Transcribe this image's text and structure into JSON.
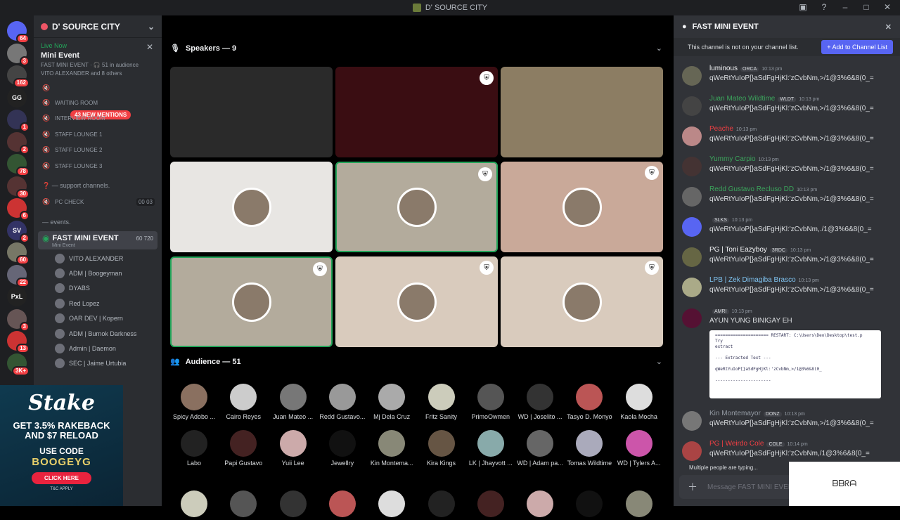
{
  "window": {
    "title": "D' SOURCE CITY"
  },
  "guilds": [
    {
      "label": "",
      "badge": "64",
      "color": "#5865f2"
    },
    {
      "label": "",
      "badge": "3",
      "color": "#777"
    },
    {
      "label": "",
      "badge": "162",
      "color": "#444"
    },
    {
      "label": "GG",
      "badge": "",
      "color": "#222"
    },
    {
      "label": "",
      "badge": "1",
      "color": "#335"
    },
    {
      "label": "",
      "badge": "2",
      "color": "#533"
    },
    {
      "label": "",
      "badge": "78",
      "color": "#353"
    },
    {
      "label": "",
      "badge": "30",
      "color": "#533"
    },
    {
      "label": "",
      "badge": "6",
      "color": "#c33"
    },
    {
      "label": "SV",
      "badge": "2",
      "color": "#336"
    },
    {
      "label": "",
      "badge": "60",
      "color": "#776"
    },
    {
      "label": "",
      "badge": "22",
      "color": "#667"
    },
    {
      "label": "PxL",
      "badge": "",
      "color": "#222"
    },
    {
      "label": "",
      "badge": "3",
      "color": "#655"
    },
    {
      "label": "",
      "badge": "13",
      "color": "#c33"
    },
    {
      "label": "",
      "badge": "3K+",
      "color": "#353"
    }
  ],
  "sidebar": {
    "server_name": "D' SOURCE CITY",
    "live_now": "Live Now",
    "event_title": "Mini Event",
    "event_sub": "FAST MINI EVENT · 🎧 51 in audience",
    "event_users": "VITO ALEXANDER and 8 others",
    "new_mentions": "43 NEW MENTIONS",
    "channels": [
      {
        "name": "WAITING ROOM",
        "icon": "🔇"
      },
      {
        "name": "INTERVIEW ROOM",
        "icon": "🔇"
      },
      {
        "name": "STAFF LOUNGE 1",
        "icon": "🔇"
      },
      {
        "name": "STAFF LOUNGE 2",
        "icon": "🔇"
      },
      {
        "name": "STAFF LOUNGE 3",
        "icon": "🔇"
      }
    ],
    "cat_support": "❓ — support channels.",
    "pc_check": "PC CHECK",
    "pc_check_count": "00 03",
    "cat_events": "— events.",
    "active_channel": "FAST MINI EVENT",
    "active_sub": "Mini Event",
    "active_counts": "60 720",
    "voice_users": [
      "VITO ALEXANDER",
      "ADM | Boogeyman",
      "DYABS",
      "Red Lopez",
      "OAR DEV | Kopern",
      "ADM | Burnok Darkness",
      "Admin | Daemon",
      "SEC | Jaime Urtubia"
    ]
  },
  "ad": {
    "brand": "Stake",
    "line1": "GET 3.5% RAKEBACK",
    "line2": "AND $7 RELOAD",
    "line3": "USE CODE",
    "code": "BOOGEYG",
    "button": "CLICK HERE",
    "terms": "T&C APPLY"
  },
  "stage": {
    "speakers_label": "Speakers — 9",
    "audience_label": "Audience — 51",
    "tiles": [
      {
        "bg": "#2a2a2a",
        "shield": false
      },
      {
        "bg": "#3a0d12",
        "shield": true
      },
      {
        "bg": "#8c7d63",
        "shield": false
      },
      {
        "bg": "#e8e6e3",
        "shield": false
      },
      {
        "bg": "#b3ab9c",
        "shield": true
      },
      {
        "bg": "#c9a999",
        "shield": true
      },
      {
        "bg": "#b3ab9c",
        "shield": true
      },
      {
        "bg": "#d9cbbd",
        "shield": true
      },
      {
        "bg": "#d9cbbd",
        "shield": true
      }
    ],
    "audience": [
      "Spicy Adobo ...",
      "Cairo Reyes",
      "Juan Mateo ...",
      "Redd Gustavo...",
      "Mj Dela Cruz",
      "Fritz Sanity",
      "PrimoOwmen",
      "WD | Joselito ...",
      "Tasyo D. Monyo",
      "Kaola Mocha",
      "Labo",
      "Papi Gustavo",
      "Yuii Lee",
      "Jewellry",
      "Kin Montema...",
      "Kira Kings",
      "LK | Jhayvott ...",
      "WD | Adam pa...",
      "Tomas Wildtime",
      "WD | Tylers A..."
    ]
  },
  "chat": {
    "title": "FAST MINI EVENT",
    "notice": "This channel is not on your channel list.",
    "add_button": "+ Add to Channel List",
    "messages": [
      {
        "name": "luminous",
        "color": "#f2f3f5",
        "tag": "ORCA",
        "time": "10:13 pm",
        "body": "qWeRtYuIoP[}aSdFgHjKl:'zCvbNm,>/1@3%6&8(0_="
      },
      {
        "name": "Juan Mateo Wildtime",
        "color": "#3ba55c",
        "tag": "WLDT",
        "time": "10:13 pm",
        "body": "qWeRtYuIoP[}aSdFgHjKl:'zCvbNm,>/1@3%6&8(0_="
      },
      {
        "name": "Peache",
        "color": "#f23f43",
        "tag": "",
        "time": "10:13 pm",
        "body": "qWeRtYuIoP[}aSdFgHjKl:'zCvbNm,>/1@3%6&8(0_="
      },
      {
        "name": "Yummy Carpio",
        "color": "#3ba55c",
        "tag": "",
        "time": "10:13 pm",
        "body": "qWeRtYuIoP[}aSdFgHjKl:'zCvbNm,>/1@3%6&8(0_="
      },
      {
        "name": "Redd Gustavo Recluso DD",
        "color": "#3ba55c",
        "tag": "",
        "time": "10:13 pm",
        "body": "qWeRtYuIoP[}aSdFgHjKl:'zCvbNm,>/1@3%6&8(0_="
      },
      {
        "name": "",
        "color": "#f2f3f5",
        "tag": "SLKS",
        "time": "10:13 pm",
        "body": "qWeRtYuIoP[}aSdFgHjKl:'zCvbNm,./1@3%6&8(0_="
      },
      {
        "name": "PG | Toni Eazyboy",
        "color": "#f2f3f5",
        "tag": "3RDC",
        "time": "10:13 pm",
        "body": "qWeRtYuIoP[}aSdFgHjKl:'zCvbNm,>/1@3%6&8(0_="
      },
      {
        "name": "LPB | Zek Dimagiba Brasco",
        "color": "#7fc3f0",
        "tag": "",
        "time": "10:13 pm",
        "body": "qWeRtYuIoP[}aSdFgHjKl:'zCvbNm,>/1@3%6&8(0_="
      },
      {
        "name": "",
        "color": "#f2f3f5",
        "tag": "AMRI",
        "time": "10:13 pm",
        "body": "AYUN YUNG BINIGAY EH"
      },
      {
        "name": "Kin Montemayor",
        "color": "#949ba4",
        "tag": "DONZ",
        "time": "10:13 pm",
        "body": "qWeRtYuIoP[}aSdFgHjKl:'zCvbNm,>/1@3%6&8(0_="
      },
      {
        "name": "PG | Weirdo Cole",
        "color": "#f23f43",
        "tag": "COLE",
        "time": "10:14 pm",
        "body": "qWeRtYuIoP[}aSdFgHjKl:'zCvbNm,/1@3%6&8(0_="
      }
    ],
    "embed_text": "===================== RESTART: C:\\Users\\Deo\\Desktop\\test.p\nTry\nextract\n\n--- Extracted Text ---\n\nqWeRtYuIoP[}aSdFgHjKl:'zCvbNm,>/1@3%6&8(0_\n\n----------------------",
    "typing": "Multiple people are typing...",
    "input_placeholder": "Message FAST MINI EVENT"
  },
  "signature": "ᗷᗷᖇᗩ"
}
